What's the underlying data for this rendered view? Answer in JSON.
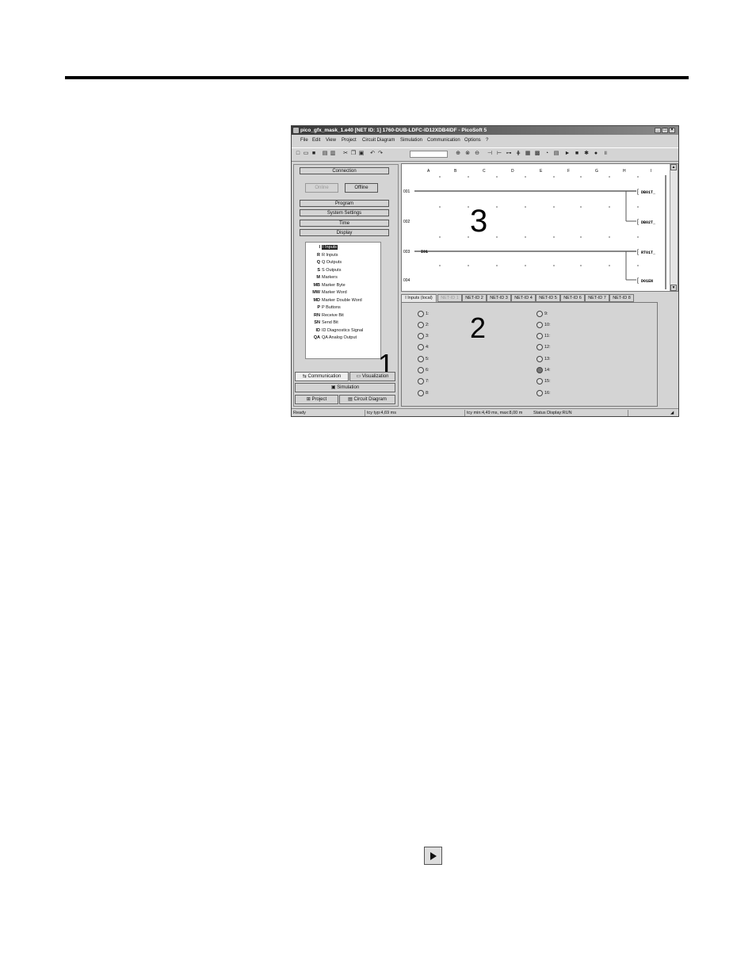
{
  "window": {
    "title": "pico_gfx_mask_1.e40 [NET ID: 1] 1760-DUB-LDFC-ID12XDB4IDF - PicoSoft 5",
    "min_label": "_",
    "max_label": "□",
    "close_label": "×"
  },
  "menu": [
    "File",
    "Edit",
    "View",
    "Project",
    "Circuit Diagram",
    "Simulation",
    "Communication",
    "Options",
    "?"
  ],
  "left_panel": {
    "connection_label": "Connection",
    "online_label": "Online",
    "offline_label": "Offline",
    "program_label": "Program",
    "system_settings_label": "System Settings",
    "time_label": "Time",
    "display_label": "Display",
    "tree": [
      {
        "code": "I",
        "label": "I Inputs",
        "selected": true
      },
      {
        "code": "R",
        "label": "R Inputs"
      },
      {
        "code": "Q",
        "label": "Q Outputs"
      },
      {
        "code": "S",
        "label": "S Outputs"
      },
      {
        "code": "M",
        "label": "Markers"
      },
      {
        "code": "MB",
        "label": "Marker Byte"
      },
      {
        "code": "MW",
        "label": "Marker Word"
      },
      {
        "code": "MD",
        "label": "Marker Double Word"
      },
      {
        "code": "P",
        "label": "P Buttons"
      },
      {
        "code": "RN",
        "label": "Receive Bit"
      },
      {
        "code": "SN",
        "label": "Send Bit"
      },
      {
        "code": "ID",
        "label": "ID Diagnostics Signal"
      },
      {
        "code": "QA",
        "label": "QA Analog Output"
      }
    ],
    "tab_communication": "Communication",
    "tab_visualization": "Visualization",
    "simulation_label": "Simulation",
    "project_label": "Project",
    "circuit_diagram_label": "Circuit Diagram"
  },
  "diagram": {
    "columns": [
      "A",
      "B",
      "C",
      "D",
      "E",
      "F",
      "G",
      "H",
      "I"
    ],
    "rows": [
      "001",
      "002",
      "003",
      "004"
    ],
    "contact_003": "I01",
    "coils": [
      "DB01T_",
      "DB02T_",
      "RT01T_",
      "D01EN"
    ]
  },
  "bottom": {
    "tabs": [
      "I Inputs (local)",
      "NET-ID 1",
      "NET-ID 2",
      "NET-ID 3",
      "NET-ID 4",
      "NET-ID 5",
      "NET-ID 6",
      "NET-ID 7",
      "NET-ID 8"
    ],
    "inputs_left": [
      "1:",
      "2:",
      "3:",
      "4:",
      "5:",
      "6:",
      "7:",
      "8:"
    ],
    "inputs_right": [
      "9:",
      "10:",
      "11:",
      "12:",
      "13:",
      "14:",
      "15:",
      "16:"
    ],
    "active_input": "14:"
  },
  "callouts": {
    "one": "1",
    "two": "2",
    "three": "3"
  },
  "status": {
    "ready": "Ready",
    "typ": "tcy typ:4,69 ms",
    "min": "tcy min:4,49 ms, max:8,00 m",
    "display": "Status Display:RUN"
  }
}
